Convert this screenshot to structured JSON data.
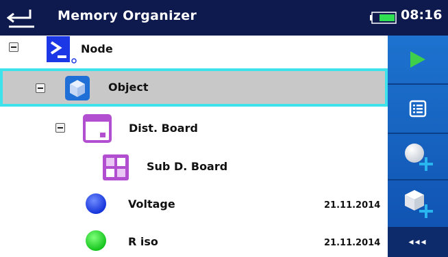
{
  "header": {
    "title": "Memory Organizer",
    "time": "08:16",
    "back_icon": "back-arrow-icon",
    "battery_icon": "battery-icon"
  },
  "tree": {
    "items": [
      {
        "label": "Node",
        "icon": "node-icon",
        "expanded": true,
        "date": ""
      },
      {
        "label": "Object",
        "icon": "object-cube-icon",
        "expanded": true,
        "selected": true,
        "date": ""
      },
      {
        "label": "Dist. Board",
        "icon": "distribution-board-icon",
        "expanded": true,
        "date": ""
      },
      {
        "label": "Sub D. Board",
        "icon": "sub-distribution-board-icon",
        "date": ""
      },
      {
        "label": "Voltage",
        "icon": "blue-status-dot-icon",
        "date": "21.11.2014"
      },
      {
        "label": "R iso",
        "icon": "green-status-dot-icon",
        "date": "21.11.2014"
      }
    ]
  },
  "sidebar": {
    "buttons": [
      "run-icon",
      "list-icon",
      "add-measurement-icon",
      "add-structure-icon"
    ],
    "more_label": "◂◂◂"
  },
  "colors": {
    "header_bg": "#0e1a4e",
    "selection_border": "#3ee2ea",
    "selection_bg": "#c8c8c8",
    "sidebar_blue": "#1d73cf",
    "run_green": "#3fcf4a",
    "plus_cyan": "#29b6f0"
  }
}
